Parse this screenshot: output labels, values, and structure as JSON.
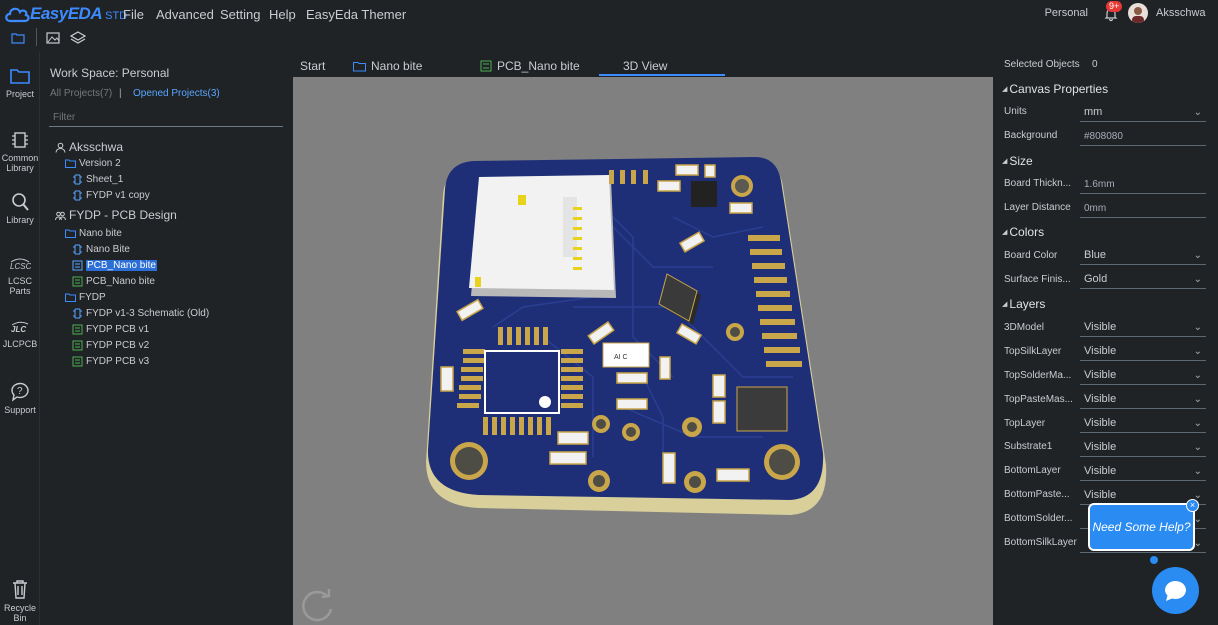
{
  "app": {
    "logo": "EasyEDA",
    "logo_suffix": "STD"
  },
  "menu": [
    "File",
    "Advanced",
    "Setting",
    "Help",
    "EasyEda Themer"
  ],
  "account": {
    "personal": "Personal",
    "notifications": "9+",
    "username": "Aksschwa"
  },
  "leftbar": [
    "Project",
    "Common Library",
    "Library",
    "LCSC Parts",
    "JLCPCB",
    "Support",
    "Recycle Bin"
  ],
  "leftbar_lines": {
    "common": [
      "Common",
      "Library"
    ],
    "lcsc": [
      "LCSC",
      "Parts"
    ],
    "recycle": [
      "Recycle",
      "Bin"
    ]
  },
  "project_panel": {
    "workspace": "Work Space: Personal",
    "all_projects": "All Projects(7)",
    "separator": "|",
    "opened_projects": "Opened Projects(3)",
    "filter_placeholder": "Filter"
  },
  "tree": {
    "aksschwa": "Aksschwa",
    "version2": "Version 2",
    "sheet1": "Sheet_1",
    "fydp_v1_copy": "FYDP v1 copy",
    "fydp_pcb_design": "FYDP - PCB Design",
    "nano_bite_folder": "Nano bite",
    "nano_bite_sch": "Nano Bite",
    "pcb_nano_bite_selected": "PCB_Nano bite",
    "pcb_nano_bite": "PCB_Nano bite",
    "fydp_folder": "FYDP",
    "fydp_v13": "FYDP v1-3 Schematic (Old)",
    "fydp_pcb_v1": "FYDP PCB v1",
    "fydp_pcb_v2": "FYDP PCB v2",
    "fydp_pcb_v3": "FYDP PCB v3"
  },
  "tabs": {
    "start": "Start",
    "nano_bite": "Nano bite",
    "pcb": "PCB_Nano bite",
    "view3d": "3D View"
  },
  "right_panel": {
    "selected_label": "Selected Objects",
    "selected_count": "0",
    "canvas_properties": "Canvas Properties",
    "units_label": "Units",
    "units_value": "mm",
    "background_label": "Background",
    "background_value": "#808080",
    "size": "Size",
    "thickness_label": "Board Thickn...",
    "thickness_value": "1.6mm",
    "layer_distance_label": "Layer Distance",
    "layer_distance_value": "0mm",
    "colors": "Colors",
    "board_color_label": "Board Color",
    "board_color_value": "Blue",
    "surface_label": "Surface Finis...",
    "surface_value": "Gold",
    "layers": "Layers",
    "layer_rows": [
      {
        "label": "3DModel",
        "value": "Visible"
      },
      {
        "label": "TopSilkLayer",
        "value": "Visible"
      },
      {
        "label": "TopSolderMa...",
        "value": "Visible"
      },
      {
        "label": "TopPasteMas...",
        "value": "Visible"
      },
      {
        "label": "TopLayer",
        "value": "Visible"
      },
      {
        "label": "Substrate1",
        "value": "Visible"
      },
      {
        "label": "BottomLayer",
        "value": "Visible"
      },
      {
        "label": "BottomPaste...",
        "value": "Visible"
      },
      {
        "label": "BottomSolder...",
        "value": ""
      },
      {
        "label": "BottomSilkLayer",
        "value": ""
      }
    ]
  },
  "help": {
    "text": "Need Some Help?",
    "close": "×"
  },
  "pcb_chip_label": "AI C",
  "colors": {
    "accent": "#3d8bff",
    "board": "#1e2f78",
    "gold": "#c9a64a",
    "canvas_bg": "#808080"
  }
}
